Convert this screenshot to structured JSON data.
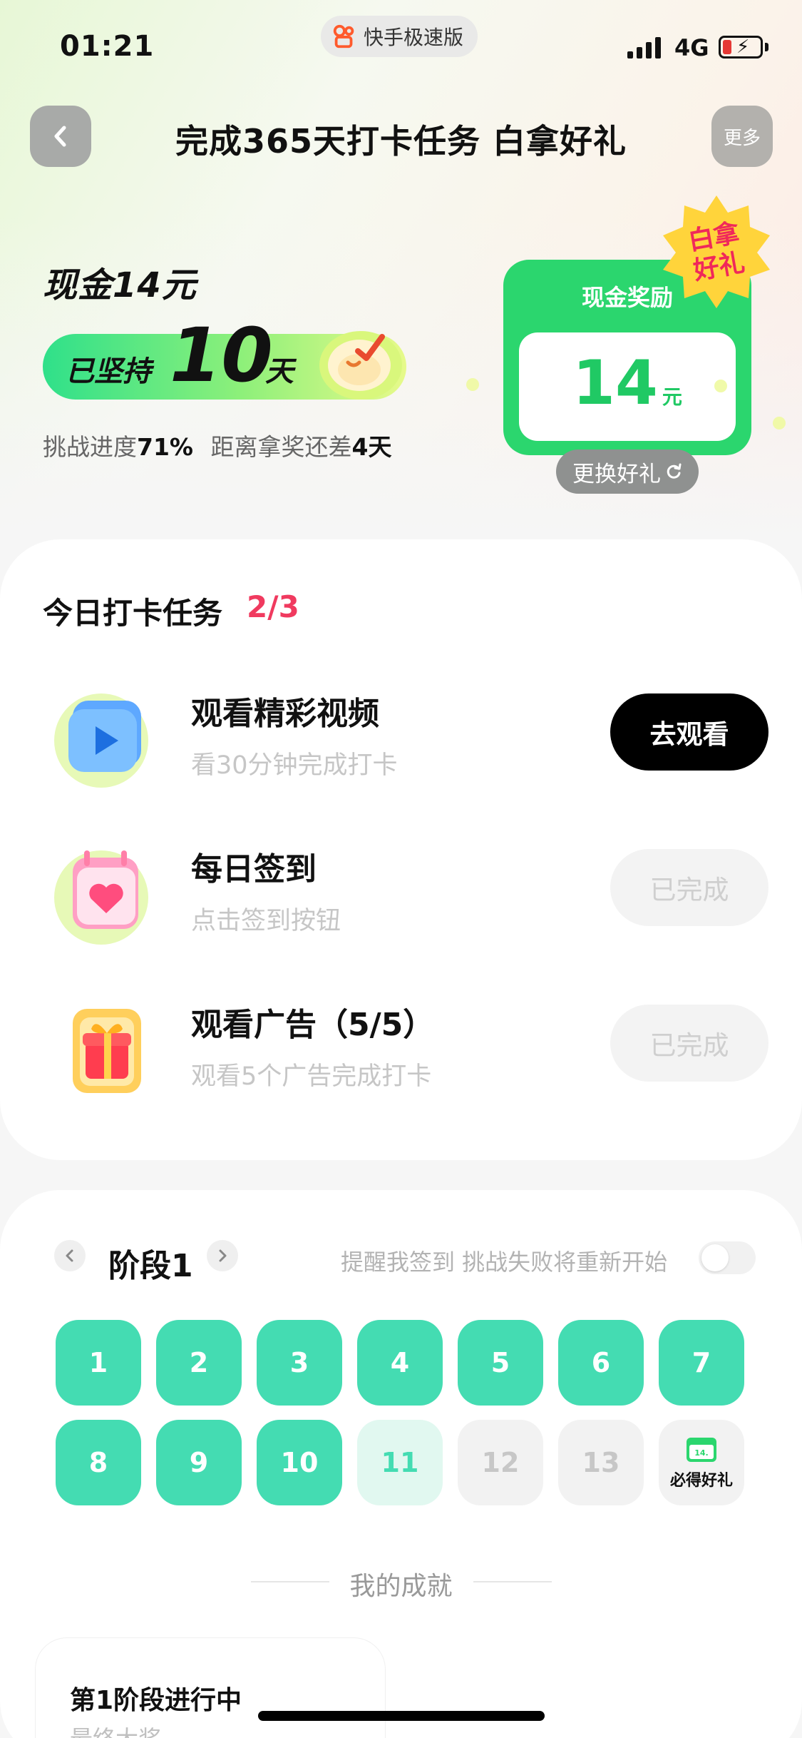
{
  "status_bar": {
    "time": "01:21",
    "app_name": "快手极速版",
    "network": "4G"
  },
  "header": {
    "title": "完成365天打卡任务 白拿好礼",
    "more_label": "更多"
  },
  "hero": {
    "cash_title": "现金14元",
    "streak_prefix": "已坚持",
    "streak_days": "10",
    "streak_suffix": "天",
    "progress_label": "挑战进度",
    "progress_value": "71%",
    "remain_label": "距离拿奖还差",
    "remain_value": "4天"
  },
  "reward_card": {
    "label": "现金奖励",
    "amount": "14",
    "unit": "元",
    "badge": "白拿好礼",
    "change_label": "更换好礼"
  },
  "tasks": {
    "heading": "今日打卡任务",
    "count": "2/3",
    "items": [
      {
        "title": "观看精彩视频",
        "subtitle": "看30分钟完成打卡",
        "button": "去观看",
        "state": "pending"
      },
      {
        "title": "每日签到",
        "subtitle": "点击签到按钮",
        "button": "已完成",
        "state": "done"
      },
      {
        "title": "观看广告（5/5）",
        "subtitle": "观看5个广告完成打卡",
        "button": "已完成",
        "state": "done"
      }
    ]
  },
  "stage": {
    "title": "阶段1",
    "remind_text": "提醒我签到 挑战失败将重新开始",
    "remind_on": false,
    "days": [
      "1",
      "2",
      "3",
      "4",
      "5",
      "6",
      "7",
      "8",
      "9",
      "10",
      "11",
      "12",
      "13"
    ],
    "completed_days": 10,
    "today": "11",
    "gift_label": "必得好礼",
    "gift_icon_text": "14."
  },
  "achievements": {
    "title": "我的成就",
    "card_stage": "第1阶段进行中",
    "card_sub": "最终大奖"
  },
  "colors": {
    "brand_green": "#2bd66e",
    "day_teal": "#44dcb2",
    "count_red": "#f03a5f"
  }
}
